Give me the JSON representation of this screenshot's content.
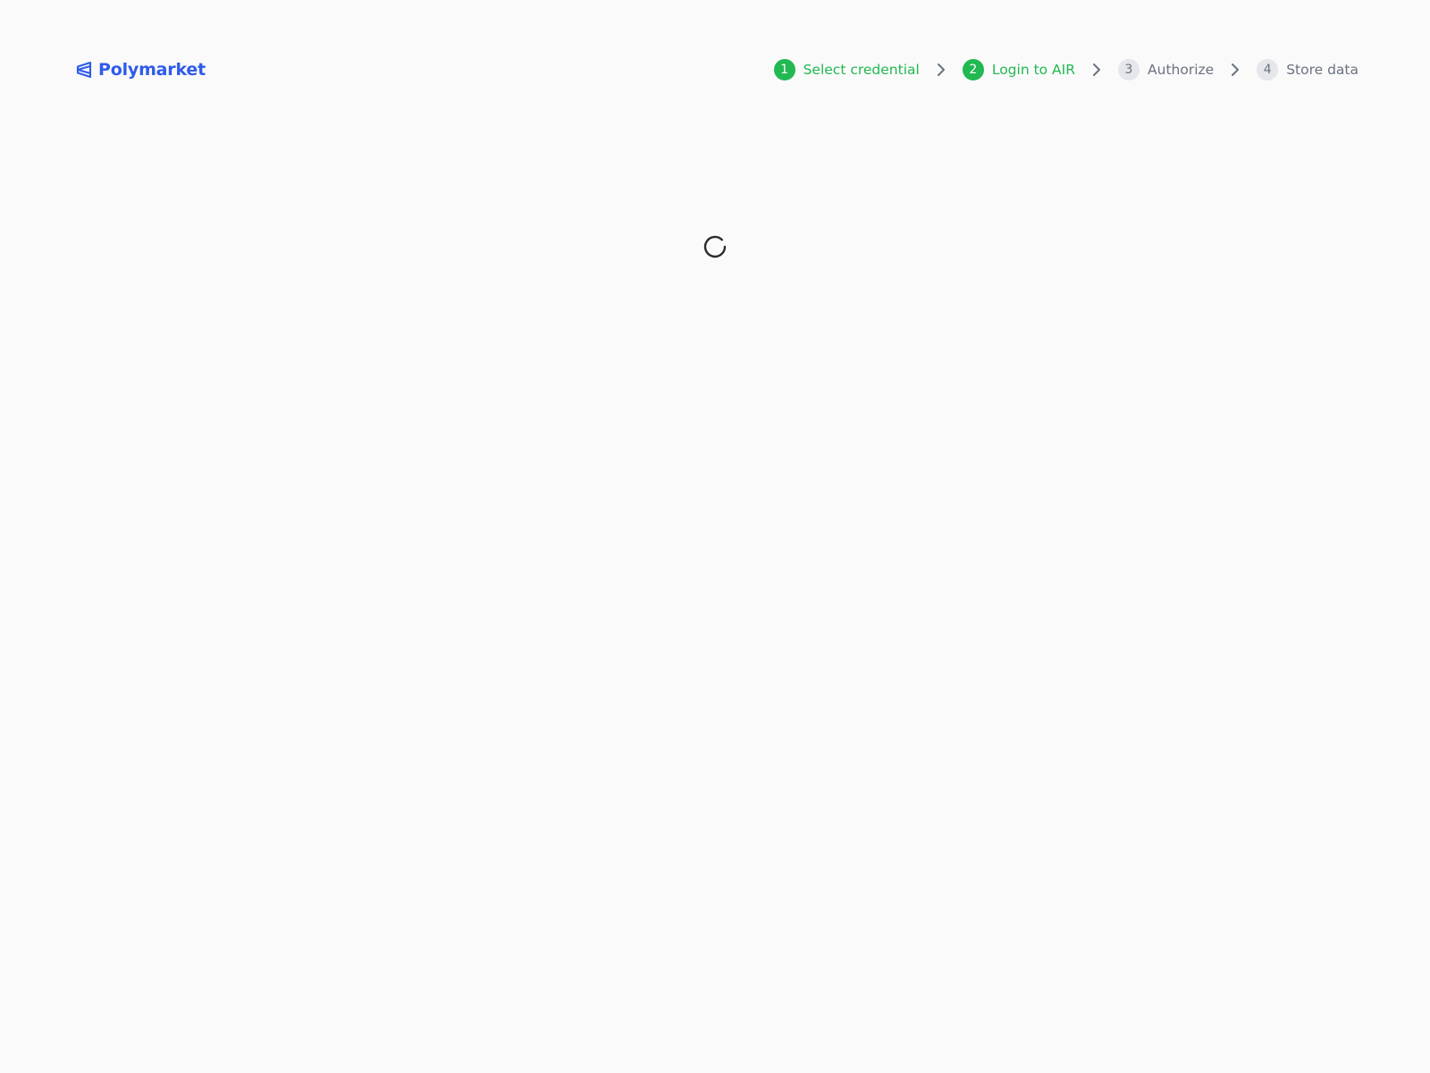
{
  "brand": {
    "name": "Polymarket",
    "icon": "polymarket-logo-icon"
  },
  "colors": {
    "brand": "#2f5bea",
    "step_done": "#22b852",
    "step_pending_text": "#6b7280",
    "chevron": "#6b7280",
    "spinner": "#2b2b2b",
    "background": "#fafafa"
  },
  "steps": [
    {
      "number": "1",
      "label": "Select credential",
      "status": "done"
    },
    {
      "number": "2",
      "label": "Login to AIR",
      "status": "done"
    },
    {
      "number": "3",
      "label": "Authorize",
      "status": "pending"
    },
    {
      "number": "4",
      "label": "Store data",
      "status": "pending"
    }
  ],
  "separator_icon": "chevron-right-icon",
  "loading": {
    "icon": "loading-spinner-icon"
  }
}
